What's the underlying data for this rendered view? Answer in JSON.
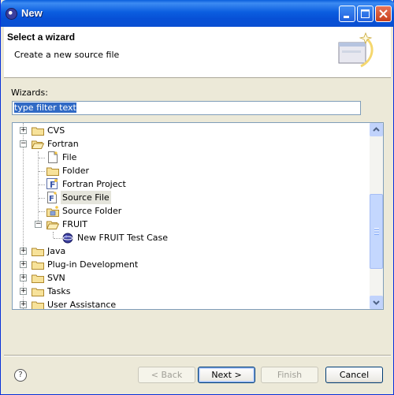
{
  "window": {
    "title": "New",
    "minimize_icon": "minimize-icon",
    "maximize_icon": "maximize-icon",
    "close_icon": "close-icon"
  },
  "header": {
    "title": "Select a wizard",
    "description": "Create a new source file"
  },
  "wizards_label": "Wizards:",
  "filter": {
    "value": "type filter text"
  },
  "tree": {
    "items": [
      {
        "label": "CVS",
        "expanded": false,
        "level": 0,
        "icon": "folder-icon"
      },
      {
        "label": "Fortran",
        "expanded": true,
        "level": 0,
        "icon": "folder-open-icon"
      },
      {
        "label": "File",
        "level": 1,
        "icon": "file-icon"
      },
      {
        "label": "Folder",
        "level": 1,
        "icon": "folder-icon"
      },
      {
        "label": "Fortran Project",
        "level": 1,
        "icon": "fortran-project-icon"
      },
      {
        "label": "Source File",
        "level": 1,
        "icon": "fortran-source-file-icon",
        "selected": true
      },
      {
        "label": "Source Folder",
        "level": 1,
        "icon": "source-folder-icon"
      },
      {
        "label": "FRUIT",
        "expanded": true,
        "level": 1,
        "icon": "folder-open-icon"
      },
      {
        "label": "New FRUIT Test Case",
        "level": 2,
        "icon": "fruit-test-case-icon"
      },
      {
        "label": "Java",
        "expanded": false,
        "level": 0,
        "icon": "folder-icon"
      },
      {
        "label": "Plug-in Development",
        "expanded": false,
        "level": 0,
        "icon": "folder-icon"
      },
      {
        "label": "SVN",
        "expanded": false,
        "level": 0,
        "icon": "folder-icon"
      },
      {
        "label": "Tasks",
        "expanded": false,
        "level": 0,
        "icon": "folder-icon"
      },
      {
        "label": "User Assistance",
        "expanded": false,
        "level": 0,
        "icon": "folder-icon"
      }
    ]
  },
  "buttons": {
    "help": "?",
    "back": "< Back",
    "next": "Next >",
    "finish": "Finish",
    "cancel": "Cancel"
  }
}
